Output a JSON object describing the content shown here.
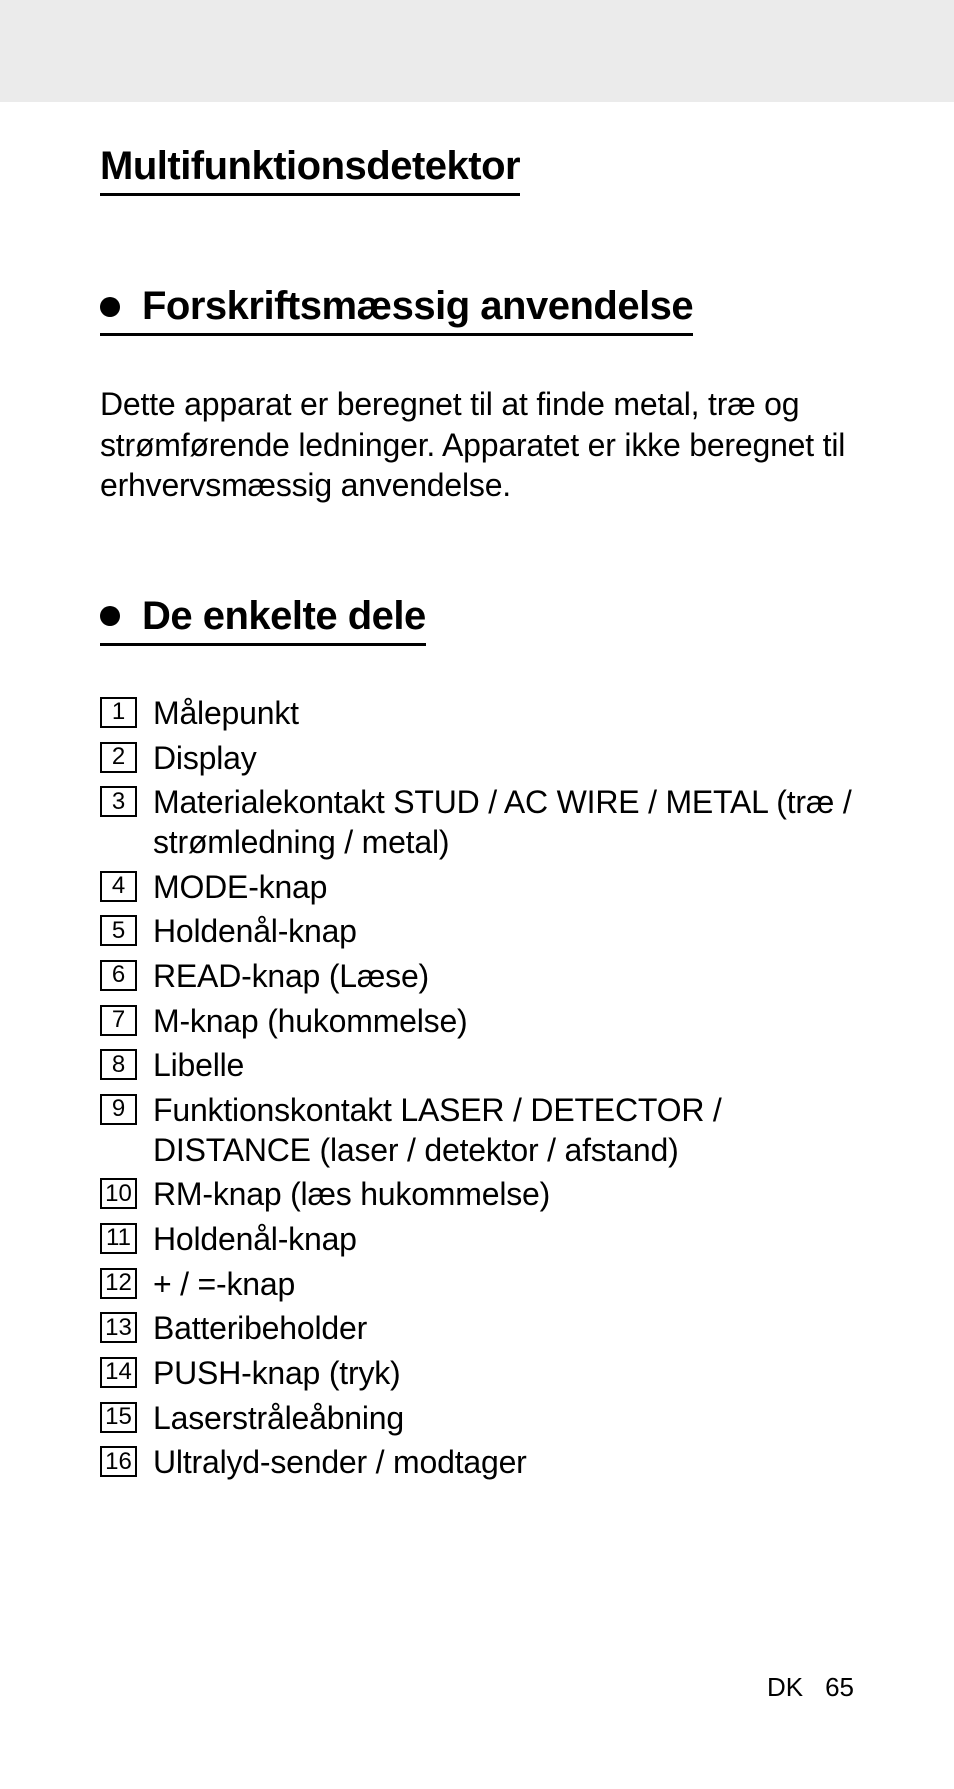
{
  "title": "Multifunktionsdetektor",
  "sections": [
    {
      "heading": "Forskriftsmæssig anvendelse",
      "body": "Dette apparat er beregnet til at finde metal, træ og strømførende ledninger.  Apparatet er ikke beregnet til erhvervsmæssig anvendelse."
    },
    {
      "heading": "De enkelte dele"
    }
  ],
  "parts": [
    {
      "num": "1",
      "text": "Målepunkt"
    },
    {
      "num": "2",
      "text": "Display"
    },
    {
      "num": "3",
      "text": "Materialekontakt STUD / AC WIRE / METAL (træ / strømledning / metal)"
    },
    {
      "num": "4",
      "text": "MODE-knap"
    },
    {
      "num": "5",
      "text": "Holdenål-knap"
    },
    {
      "num": "6",
      "text": "READ-knap (Læse)"
    },
    {
      "num": "7",
      "text": "M-knap (hukommelse)"
    },
    {
      "num": "8",
      "text": "Libelle"
    },
    {
      "num": "9",
      "text": "Funktionskontakt LASER / DETECTOR / DISTANCE (laser / detektor / afstand)"
    },
    {
      "num": "10",
      "text": "RM-knap (læs hukommelse)"
    },
    {
      "num": "11",
      "text": "Holdenål-knap"
    },
    {
      "num": "12",
      "text": "+ / =-knap"
    },
    {
      "num": "13",
      "text": "Batteribeholder"
    },
    {
      "num": "14",
      "text": "PUSH-knap (tryk)"
    },
    {
      "num": "15",
      "text": "Laserstråleåbning"
    },
    {
      "num": "16",
      "text": "Ultralyd-sender / modtager"
    }
  ],
  "footer": {
    "country": "DK",
    "page": "65"
  }
}
